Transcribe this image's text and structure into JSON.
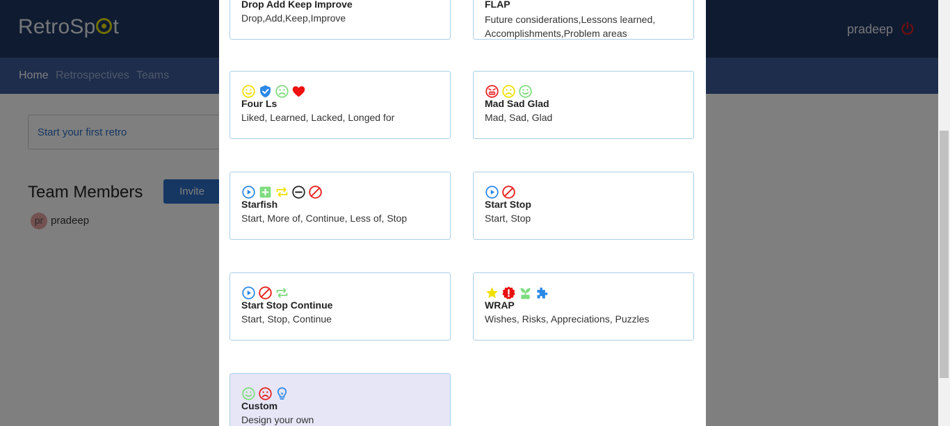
{
  "app": {
    "logo": "RetroSpot",
    "user": "pradeep",
    "nav": [
      "Home",
      "Retrospectives",
      "Teams"
    ],
    "first_retro_link": "Start your first retro",
    "team_members_title": "Team Members",
    "invite_label": "Invite",
    "members": [
      {
        "initials": "pr",
        "name": "pradeep"
      }
    ]
  },
  "templates": [
    {
      "name": "Drop Add Keep Improve",
      "description": "Drop,Add,Keep,Improve",
      "icons": []
    },
    {
      "name": "FLAP",
      "description": "Future considerations,Lessons learned, Accomplishments,Problem areas",
      "icons": []
    },
    {
      "name": "Four Ls",
      "description": "Liked, Learned, Lacked, Longed for",
      "icons": [
        "smile-icon",
        "shield-check-icon",
        "sad-icon",
        "heart-icon"
      ]
    },
    {
      "name": "Mad Sad Glad",
      "description": "Mad, Sad, Glad",
      "icons": [
        "angry-icon",
        "sad-icon",
        "smile-icon"
      ]
    },
    {
      "name": "Starfish",
      "description": "Start, More of, Continue, Less of, Stop",
      "icons": [
        "play-circle-icon",
        "plus-square-icon",
        "repeat-icon",
        "minus-circle-icon",
        "ban-icon"
      ]
    },
    {
      "name": "Start Stop",
      "description": "Start, Stop",
      "icons": [
        "play-circle-icon",
        "ban-icon"
      ]
    },
    {
      "name": "Start Stop Continue",
      "description": "Start, Stop, Continue",
      "icons": [
        "play-circle-icon",
        "ban-icon",
        "repeat-icon"
      ]
    },
    {
      "name": "WRAP",
      "description": "Wishes, Risks, Appreciations, Puzzles",
      "icons": [
        "star-icon",
        "alert-badge-icon",
        "seedling-icon",
        "puzzle-icon"
      ]
    },
    {
      "name": "Custom",
      "description": "Design your own",
      "icons": [
        "smile-icon",
        "sad-icon",
        "lightbulb-icon"
      ]
    }
  ],
  "colors": {
    "topbar": "#1f3660",
    "navbar": "#3c5a99",
    "card_border": "#a9cfe6",
    "custom_bg": "#e6e6f7",
    "invite": "#2e6fc7"
  }
}
